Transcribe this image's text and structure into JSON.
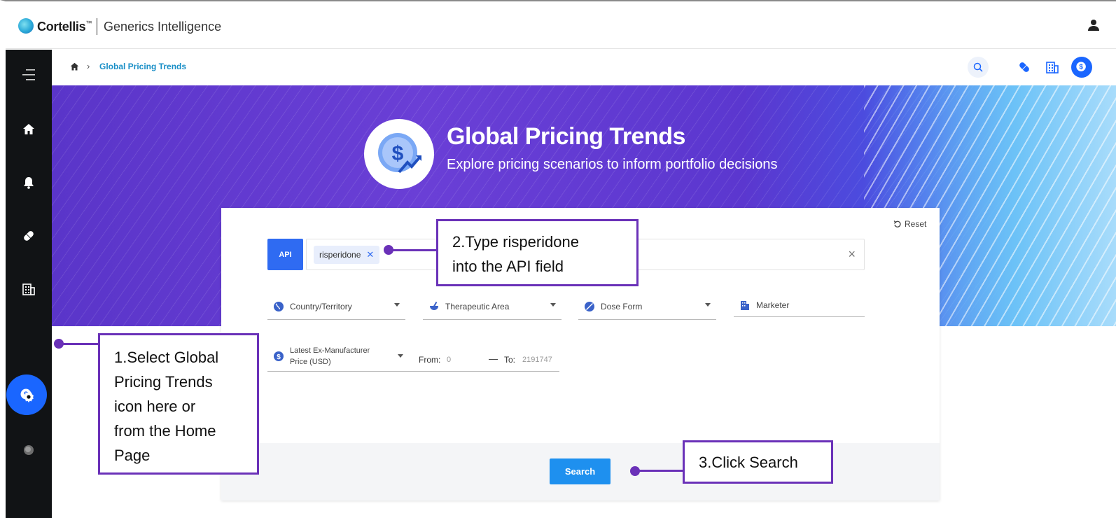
{
  "brand": {
    "name": "Cortellis",
    "tm": "™",
    "product": "Generics Intelligence"
  },
  "breadcrumb": {
    "current": "Global Pricing Trends"
  },
  "hero": {
    "title": "Global Pricing Trends",
    "subtitle": "Explore pricing scenarios to inform portfolio decisions"
  },
  "search": {
    "reset_label": "Reset",
    "api_tag": "API",
    "api_chip": "risperidone",
    "api_chip_remove": "✕",
    "api_clear": "×",
    "filters": {
      "country": "Country/Territory",
      "therapeutic": "Therapeutic Area",
      "dose_form": "Dose Form",
      "marketer": "Marketer"
    },
    "price": {
      "label": "Latest Ex-Manufacturer Price (USD)",
      "from_label": "From:",
      "from_value": "0",
      "dash": "—",
      "to_label": "To:",
      "to_value": "2191747"
    },
    "search_button": "Search"
  },
  "callouts": {
    "step1": [
      "1.Select Global",
      "Pricing Trends",
      "icon here or",
      "from the Home",
      "Page"
    ],
    "step2": [
      "2.Type risperidone",
      "into the API field"
    ],
    "step3": "3.Click Search"
  },
  "icons": {
    "menu": "hamburger-icon",
    "home": "home-icon",
    "alerts": "bell-icon",
    "pill": "pill-icon",
    "company": "building-icon",
    "pricing": "dollar-coin-icon",
    "settings": "gear-icon",
    "logo": "cortellis-logo-icon",
    "search": "search-icon",
    "user": "user-icon"
  },
  "colors": {
    "accent": "#1a66ff",
    "callout": "#6a31b8",
    "search_button": "#1e90ef",
    "breadcrumb": "#1a8fc7"
  }
}
